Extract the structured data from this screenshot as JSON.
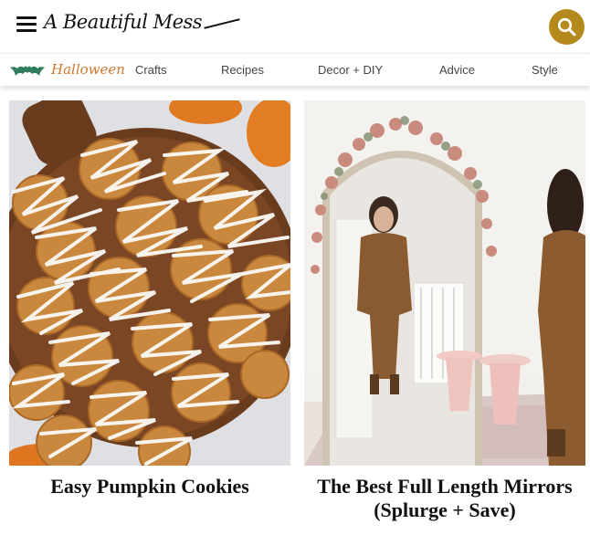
{
  "header": {
    "logo_text": "A Beautiful Mess",
    "menu_icon": "hamburger-icon",
    "search_icon": "search-icon",
    "accent_color": "#b58a1c"
  },
  "nav": {
    "featured": {
      "label": "Halloween",
      "icon": "bat-icon",
      "color": "#d2782b"
    },
    "items": [
      {
        "label": "Crafts"
      },
      {
        "label": "Recipes"
      },
      {
        "label": "Decor + DIY"
      },
      {
        "label": "Advice"
      },
      {
        "label": "Style"
      }
    ]
  },
  "posts": [
    {
      "title": "Easy Pumpkin Cookies",
      "image": "pumpkin-cookies-photo"
    },
    {
      "title": "The Best Full Length Mirrors (Splurge + Save)",
      "image": "arched-mirror-photo"
    }
  ]
}
